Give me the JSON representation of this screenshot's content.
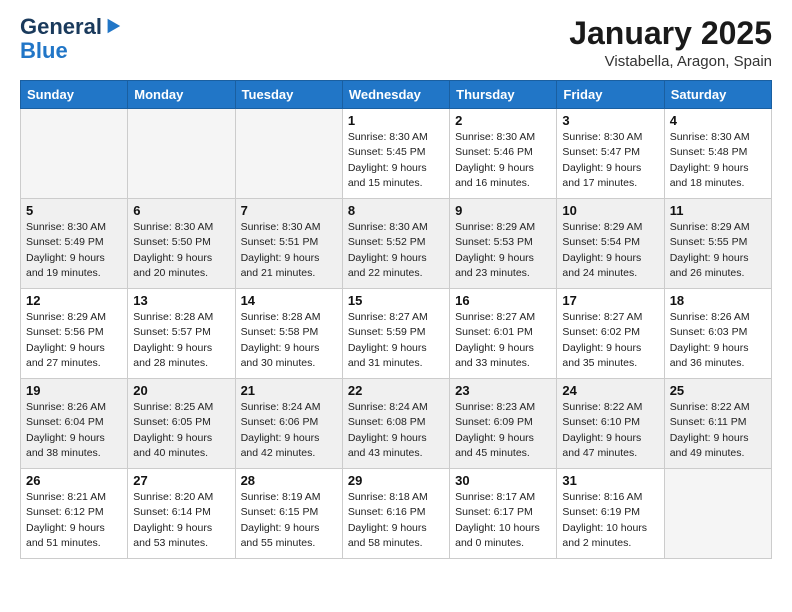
{
  "header": {
    "logo": {
      "general": "General",
      "blue": "Blue"
    },
    "month": "January 2025",
    "location": "Vistabella, Aragon, Spain"
  },
  "weekdays": [
    "Sunday",
    "Monday",
    "Tuesday",
    "Wednesday",
    "Thursday",
    "Friday",
    "Saturday"
  ],
  "weeks": [
    {
      "shaded": false,
      "days": [
        {
          "number": "",
          "info": ""
        },
        {
          "number": "",
          "info": ""
        },
        {
          "number": "",
          "info": ""
        },
        {
          "number": "1",
          "info": "Sunrise: 8:30 AM\nSunset: 5:45 PM\nDaylight: 9 hours\nand 15 minutes."
        },
        {
          "number": "2",
          "info": "Sunrise: 8:30 AM\nSunset: 5:46 PM\nDaylight: 9 hours\nand 16 minutes."
        },
        {
          "number": "3",
          "info": "Sunrise: 8:30 AM\nSunset: 5:47 PM\nDaylight: 9 hours\nand 17 minutes."
        },
        {
          "number": "4",
          "info": "Sunrise: 8:30 AM\nSunset: 5:48 PM\nDaylight: 9 hours\nand 18 minutes."
        }
      ]
    },
    {
      "shaded": true,
      "days": [
        {
          "number": "5",
          "info": "Sunrise: 8:30 AM\nSunset: 5:49 PM\nDaylight: 9 hours\nand 19 minutes."
        },
        {
          "number": "6",
          "info": "Sunrise: 8:30 AM\nSunset: 5:50 PM\nDaylight: 9 hours\nand 20 minutes."
        },
        {
          "number": "7",
          "info": "Sunrise: 8:30 AM\nSunset: 5:51 PM\nDaylight: 9 hours\nand 21 minutes."
        },
        {
          "number": "8",
          "info": "Sunrise: 8:30 AM\nSunset: 5:52 PM\nDaylight: 9 hours\nand 22 minutes."
        },
        {
          "number": "9",
          "info": "Sunrise: 8:29 AM\nSunset: 5:53 PM\nDaylight: 9 hours\nand 23 minutes."
        },
        {
          "number": "10",
          "info": "Sunrise: 8:29 AM\nSunset: 5:54 PM\nDaylight: 9 hours\nand 24 minutes."
        },
        {
          "number": "11",
          "info": "Sunrise: 8:29 AM\nSunset: 5:55 PM\nDaylight: 9 hours\nand 26 minutes."
        }
      ]
    },
    {
      "shaded": false,
      "days": [
        {
          "number": "12",
          "info": "Sunrise: 8:29 AM\nSunset: 5:56 PM\nDaylight: 9 hours\nand 27 minutes."
        },
        {
          "number": "13",
          "info": "Sunrise: 8:28 AM\nSunset: 5:57 PM\nDaylight: 9 hours\nand 28 minutes."
        },
        {
          "number": "14",
          "info": "Sunrise: 8:28 AM\nSunset: 5:58 PM\nDaylight: 9 hours\nand 30 minutes."
        },
        {
          "number": "15",
          "info": "Sunrise: 8:27 AM\nSunset: 5:59 PM\nDaylight: 9 hours\nand 31 minutes."
        },
        {
          "number": "16",
          "info": "Sunrise: 8:27 AM\nSunset: 6:01 PM\nDaylight: 9 hours\nand 33 minutes."
        },
        {
          "number": "17",
          "info": "Sunrise: 8:27 AM\nSunset: 6:02 PM\nDaylight: 9 hours\nand 35 minutes."
        },
        {
          "number": "18",
          "info": "Sunrise: 8:26 AM\nSunset: 6:03 PM\nDaylight: 9 hours\nand 36 minutes."
        }
      ]
    },
    {
      "shaded": true,
      "days": [
        {
          "number": "19",
          "info": "Sunrise: 8:26 AM\nSunset: 6:04 PM\nDaylight: 9 hours\nand 38 minutes."
        },
        {
          "number": "20",
          "info": "Sunrise: 8:25 AM\nSunset: 6:05 PM\nDaylight: 9 hours\nand 40 minutes."
        },
        {
          "number": "21",
          "info": "Sunrise: 8:24 AM\nSunset: 6:06 PM\nDaylight: 9 hours\nand 42 minutes."
        },
        {
          "number": "22",
          "info": "Sunrise: 8:24 AM\nSunset: 6:08 PM\nDaylight: 9 hours\nand 43 minutes."
        },
        {
          "number": "23",
          "info": "Sunrise: 8:23 AM\nSunset: 6:09 PM\nDaylight: 9 hours\nand 45 minutes."
        },
        {
          "number": "24",
          "info": "Sunrise: 8:22 AM\nSunset: 6:10 PM\nDaylight: 9 hours\nand 47 minutes."
        },
        {
          "number": "25",
          "info": "Sunrise: 8:22 AM\nSunset: 6:11 PM\nDaylight: 9 hours\nand 49 minutes."
        }
      ]
    },
    {
      "shaded": false,
      "days": [
        {
          "number": "26",
          "info": "Sunrise: 8:21 AM\nSunset: 6:12 PM\nDaylight: 9 hours\nand 51 minutes."
        },
        {
          "number": "27",
          "info": "Sunrise: 8:20 AM\nSunset: 6:14 PM\nDaylight: 9 hours\nand 53 minutes."
        },
        {
          "number": "28",
          "info": "Sunrise: 8:19 AM\nSunset: 6:15 PM\nDaylight: 9 hours\nand 55 minutes."
        },
        {
          "number": "29",
          "info": "Sunrise: 8:18 AM\nSunset: 6:16 PM\nDaylight: 9 hours\nand 58 minutes."
        },
        {
          "number": "30",
          "info": "Sunrise: 8:17 AM\nSunset: 6:17 PM\nDaylight: 10 hours\nand 0 minutes."
        },
        {
          "number": "31",
          "info": "Sunrise: 8:16 AM\nSunset: 6:19 PM\nDaylight: 10 hours\nand 2 minutes."
        },
        {
          "number": "",
          "info": ""
        }
      ]
    }
  ]
}
